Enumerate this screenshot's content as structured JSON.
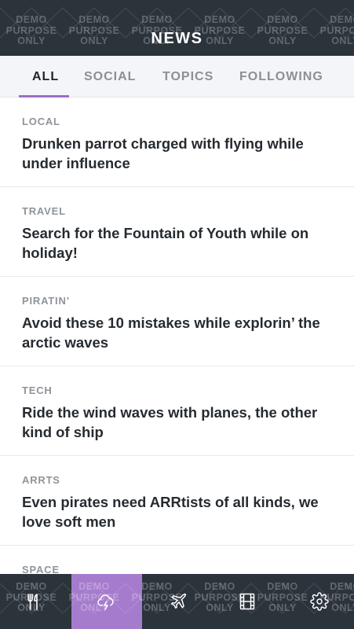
{
  "header": {
    "title": "NEWS"
  },
  "tabs": [
    {
      "label": "ALL",
      "active": true
    },
    {
      "label": "SOCIAL",
      "active": false
    },
    {
      "label": "TOPICS",
      "active": false
    },
    {
      "label": "FOLLOWING",
      "active": false
    }
  ],
  "news": [
    {
      "category": "LOCAL",
      "headline": "Drunken parrot charged with flying while under influence"
    },
    {
      "category": "TRAVEL",
      "headline": "Search for the Fountain of Youth while on holiday!"
    },
    {
      "category": "PIRATIN’",
      "headline": "Avoid these 10 mistakes while explorin’ the arctic waves"
    },
    {
      "category": "TECH",
      "headline": "Ride the wind waves with planes, the other kind of ship"
    },
    {
      "category": "ARRTS",
      "headline": "Even pirates need ARRtists of all kinds, we love soft men"
    },
    {
      "category": "SPACE",
      "headline": ""
    }
  ],
  "bottom_nav": [
    {
      "icon": "fork-knife-icon",
      "active": false
    },
    {
      "icon": "storm-cloud-icon",
      "active": true
    },
    {
      "icon": "airplane-icon",
      "active": false
    },
    {
      "icon": "film-strip-icon",
      "active": false
    },
    {
      "icon": "gear-icon",
      "active": false
    }
  ],
  "watermark": {
    "line1": "DEMO",
    "line2": "PURPOSE",
    "line3": "ONLY"
  },
  "colors": {
    "bar_bg": "#2b333b",
    "accent": "#a57ccd",
    "tab_indicator": "#9b6fc6",
    "tabs_bg": "#f3f5f8",
    "headline": "#262b30",
    "category": "#8f949a"
  }
}
